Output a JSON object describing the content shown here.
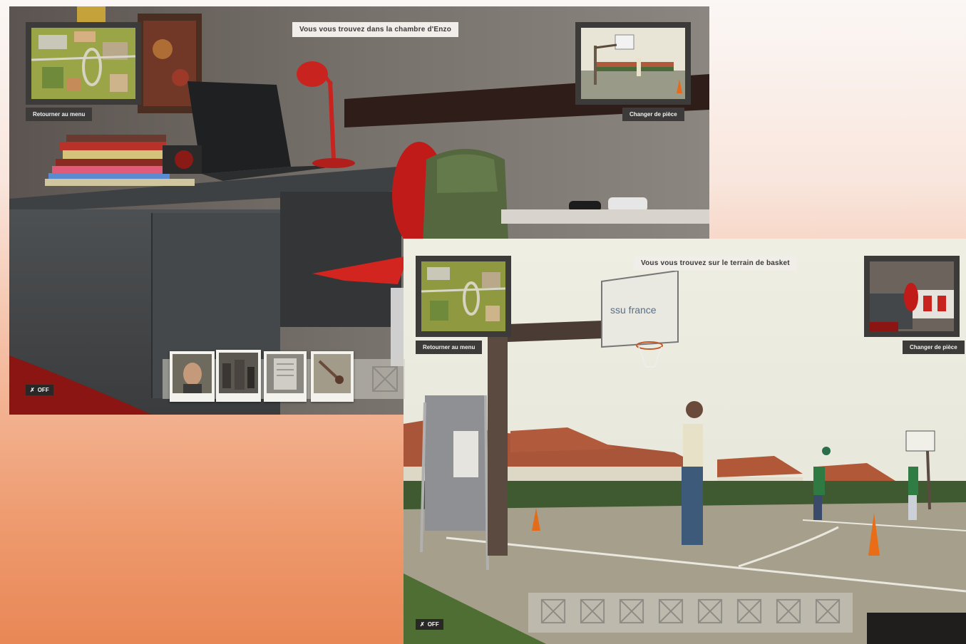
{
  "room_scene": {
    "caption": "Vous vous trouvez dans la chambre d'Enzo",
    "menu_button": "Retourner au menu",
    "room_button": "Changer de pièce",
    "sound_toggle": "OFF",
    "map_thumbnail_icon": "aerial-map-icon",
    "next_room_thumbnail_icon": "basketball-court-icon",
    "collected_photos": [
      "portrait-photo",
      "group-photo",
      "note-photo",
      "object-photo"
    ],
    "empty_slots": 1
  },
  "court_scene": {
    "caption": "Vous vous trouvez sur le terrain de basket",
    "menu_button": "Retourner au menu",
    "room_button": "Changer de pièce",
    "sound_toggle": "OFF",
    "map_thumbnail_icon": "aerial-map-icon",
    "next_room_thumbnail_icon": "bedroom-icon",
    "empty_slots": 8,
    "backboard_text": "ssu france"
  },
  "colors": {
    "panel_dark": "#3d3b39",
    "caption_bg": "#f1eee9",
    "backdrop_top": "#fbf7f5",
    "backdrop_bottom": "#e98756",
    "accent_red": "#c8231e"
  }
}
